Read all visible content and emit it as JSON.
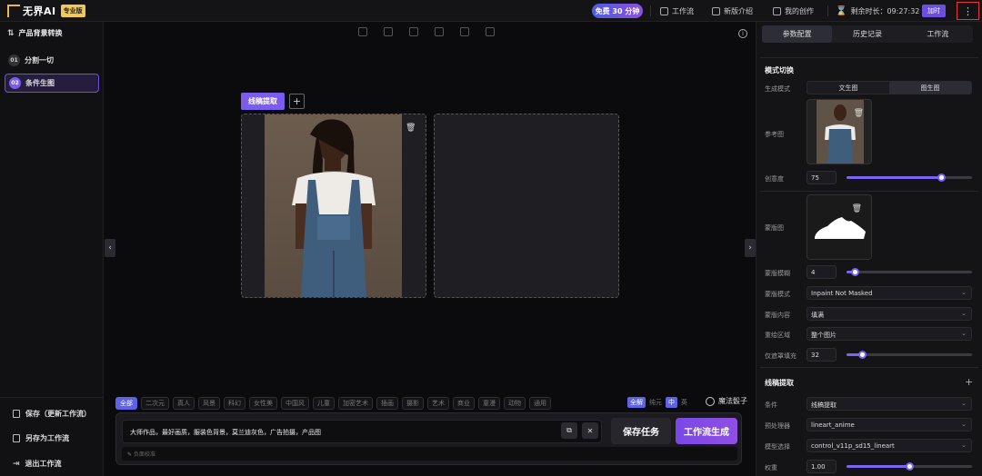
{
  "topbar": {
    "logo_text": "无界AI",
    "badge": "专业版",
    "free_pill": "免费 30 分钟",
    "workflow": "工作流",
    "new_intro": "新版介绍",
    "my_works": "我的创作",
    "remaining": "剩余时长：09:27:32",
    "recharge": "加时",
    "more": "⋮"
  },
  "sidebar": {
    "title": "产品背景转换",
    "steps": [
      {
        "num": "01",
        "label": "分割一切"
      },
      {
        "num": "02",
        "label": "条件生图"
      }
    ],
    "actions": [
      {
        "label": "保存（更新工作流）"
      },
      {
        "label": "另存为工作流"
      },
      {
        "label": "退出工作流"
      }
    ]
  },
  "canvas": {
    "tag_chip": "线稿提取",
    "add": "+"
  },
  "style_tags": [
    "全部",
    "二次元",
    "真人",
    "风景",
    "科幻",
    "女性美",
    "中国风",
    "儿童",
    "加密艺术",
    "插画",
    "摄影",
    "艺术",
    "商业",
    "童漫",
    "动物",
    "通用"
  ],
  "tag_right": {
    "a": "全解",
    "b": "纯元",
    "c": "中",
    "d": "英"
  },
  "magic": "魔法骰子",
  "prompt": {
    "value": "大师作品，最好画质，服装色背景，莫兰迪灰色，广告拍摄，产品图",
    "negative_placeholder": "负面校准",
    "copy": "⧉",
    "clear": "✕",
    "save_task": "保存任务",
    "run": "工作流生成"
  },
  "rpanel": {
    "tabs": [
      "参数配置",
      "历史记录",
      "工作流"
    ],
    "mode_title": "模式切换",
    "gen_mode_label": "生成模式",
    "gen_modes": [
      "文生图",
      "图生图"
    ],
    "ref_label": "参考图",
    "creativity_label": "创意度",
    "creativity_value": "75",
    "creativity": 75,
    "mask_label": "蒙版图",
    "mask_blur_label": "蒙版模糊",
    "mask_blur_value": "4",
    "mask_blur": 4,
    "mask_mode_label": "蒙版模式",
    "mask_mode_value": "Inpaint Not Masked",
    "mask_content_label": "蒙版内容",
    "mask_content_value": "填满",
    "redraw_area_label": "重绘区域",
    "redraw_area_value": "整个图片",
    "padding_label": "仅遮罩填充",
    "padding_value": "32",
    "padding": 32,
    "lineart_title": "线稿提取",
    "condition_label": "条件",
    "condition_value": "线稿提取",
    "preprocessor_label": "预处理器",
    "preprocessor_value": "lineart_anime",
    "model_label": "模型选择",
    "model_value": "control_v11p_sd15_lineart",
    "weight_label": "权重",
    "weight_value": "1.00",
    "weight": 1.0
  }
}
